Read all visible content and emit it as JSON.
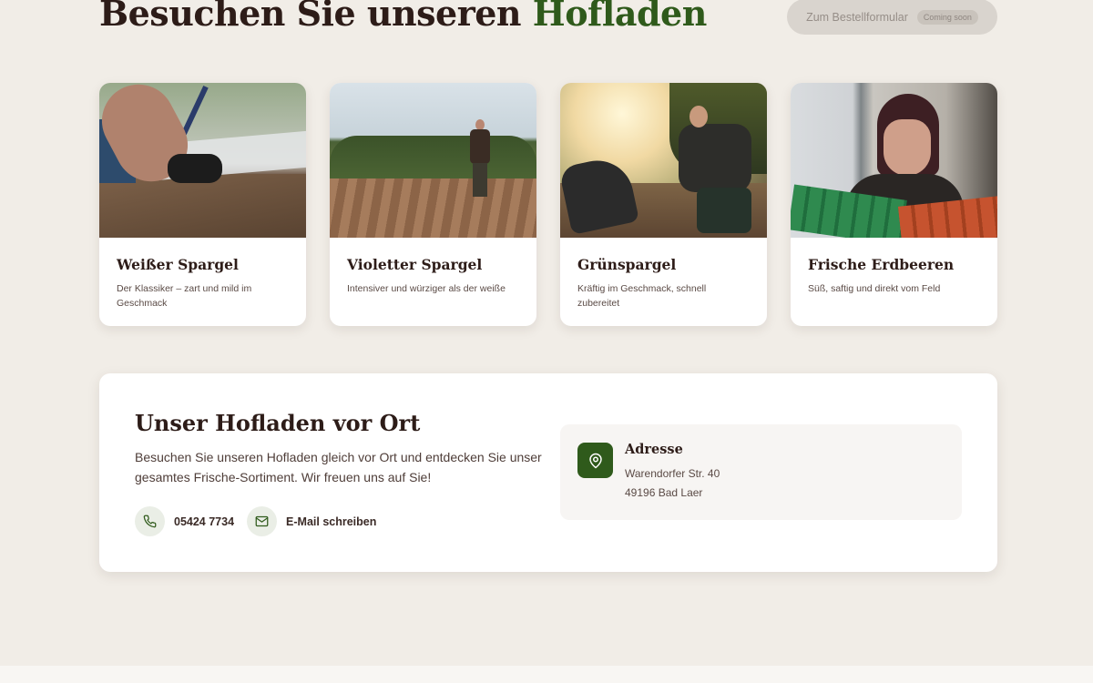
{
  "header": {
    "title_main": "Besuchen Sie unseren",
    "title_accent": "Hofladen",
    "order_button": {
      "label": "Zum Bestellformular",
      "badge": "Coming soon"
    }
  },
  "products": [
    {
      "title": "Weißer Spargel",
      "description": "Der Klassiker – zart und mild im Geschmack"
    },
    {
      "title": "Violetter Spargel",
      "description": "Intensiver und würziger als der weiße"
    },
    {
      "title": "Grünspargel",
      "description": "Kräftig im Geschmack, schnell zubereitet"
    },
    {
      "title": "Frische Erdbeeren",
      "description": "Süß, saftig und direkt vom Feld"
    }
  ],
  "shop": {
    "title": "Unser Hofladen vor Ort",
    "description": "Besuchen Sie unseren Hofladen gleich vor Ort und entdecken Sie unser gesamtes Frische-Sortiment. Wir freuen uns auf Sie!",
    "phone": "05424 7734",
    "email_label": "E-Mail schreiben",
    "address": {
      "heading": "Adresse",
      "street": "Warendorfer Str. 40",
      "city": "49196 Bad Laer"
    }
  },
  "colors": {
    "accent_green": "#2f5a1b",
    "background": "#f1ede7",
    "heading": "#2d1c18"
  },
  "icons": [
    "phone-icon",
    "mail-icon",
    "map-pin-icon"
  ]
}
